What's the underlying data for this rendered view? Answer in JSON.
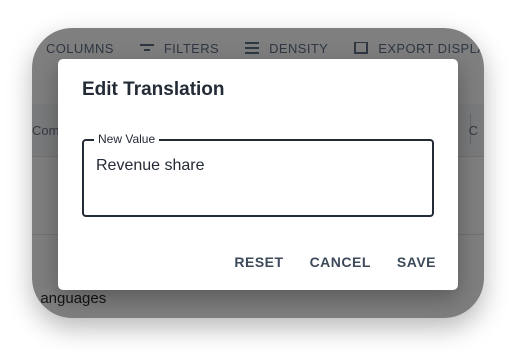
{
  "background": {
    "toolbar": {
      "columns_label": "COLUMNS",
      "filters_label": "FILTERS",
      "density_label": "DENSITY",
      "export_label": "EXPORT DISPLAY"
    },
    "table": {
      "header_left": "Commis",
      "header_right": "C"
    },
    "section_label": "Languages"
  },
  "dialog": {
    "title": "Edit Translation",
    "field": {
      "label": "New Value",
      "value": "Revenue share"
    },
    "actions": {
      "reset_label": "RESET",
      "cancel_label": "CANCEL",
      "save_label": "SAVE"
    }
  },
  "colors": {
    "backdrop": "#000000",
    "dialog_text": "#232b36",
    "button_text": "#3d4a5a"
  }
}
